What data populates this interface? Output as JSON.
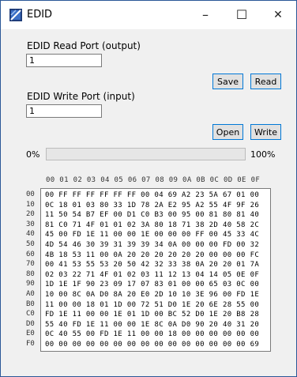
{
  "window": {
    "title": "EDID",
    "minimize": "–",
    "maximize": "☐",
    "close": "✕"
  },
  "read_port": {
    "label": "EDID Read Port (output)",
    "value": "1"
  },
  "write_port": {
    "label": "EDID Write Port (input)",
    "value": "1"
  },
  "buttons": {
    "save": "Save",
    "read": "Read",
    "open": "Open",
    "write": "Write"
  },
  "progress": {
    "start_label": "0%",
    "end_label": "100%",
    "fraction": 0
  },
  "hex": {
    "column_header": "00 01 02 03 04 05 06 07 08 09 0A 0B 0C 0D 0E 0F",
    "addresses": [
      "00",
      "10",
      "20",
      "30",
      "40",
      "50",
      "60",
      "70",
      "80",
      "90",
      "A0",
      "B0",
      "C0",
      "D0",
      "E0",
      "F0"
    ],
    "rows": [
      "00 FF FF FF FF FF FF 00 04 69 A2 23 5A 67 01 00",
      "0C 18 01 03 80 33 1D 78 2A E2 95 A2 55 4F 9F 26",
      "11 50 54 B7 EF 00 D1 C0 B3 00 95 00 81 80 81 40",
      "81 C0 71 4F 01 01 02 3A 80 18 71 38 2D 40 58 2C",
      "45 00 FD 1E 11 00 00 1E 00 00 00 FF 00 45 33 4C",
      "4D 54 46 30 39 31 39 39 34 0A 00 00 00 FD 00 32",
      "4B 18 53 11 00 0A 20 20 20 20 20 20 00 00 00 FC",
      "00 41 53 55 53 20 50 42 32 33 38 0A 20 20 01 7A",
      "02 03 22 71 4F 01 02 03 11 12 13 04 14 05 0E 0F",
      "1D 1E 1F 90 23 09 17 07 83 01 00 00 65 03 0C 00",
      "10 00 8C 0A D0 8A 20 E0 2D 10 10 3E 96 00 FD 1E",
      "11 00 00 18 01 1D 00 72 51 D0 1E 20 6E 28 55 00",
      "FD 1E 11 00 00 1E 01 1D 00 BC 52 D0 1E 20 B8 28",
      "55 40 FD 1E 11 00 00 1E 8C 0A D0 90 20 40 31 20",
      "0C 40 55 00 FD 1E 11 00 00 18 00 00 00 00 00 00",
      "00 00 00 00 00 00 00 00 00 00 00 00 00 00 00 69"
    ]
  }
}
